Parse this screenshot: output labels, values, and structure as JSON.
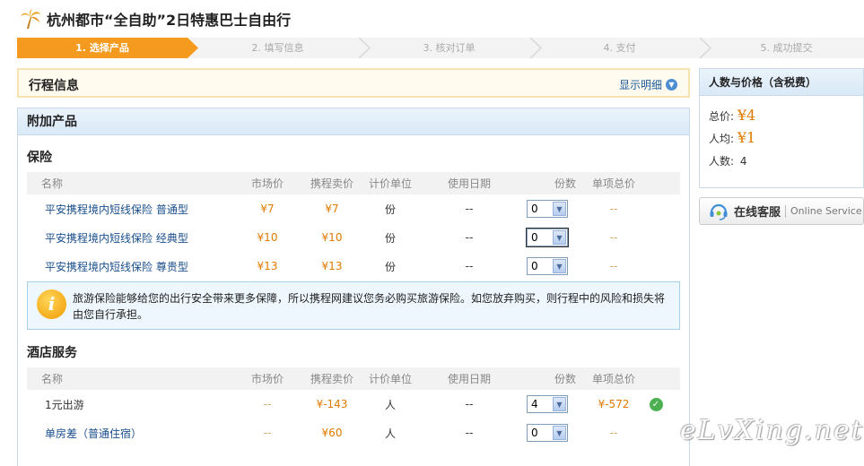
{
  "page": {
    "title": "杭州都市“全自助”2日特惠巴士自由行"
  },
  "steps": [
    {
      "label": "1. 选择产品",
      "active": true
    },
    {
      "label": "2. 填写信息",
      "active": false
    },
    {
      "label": "3. 核对订单",
      "active": false
    },
    {
      "label": "4. 支付",
      "active": false
    },
    {
      "label": "5. 成功提交",
      "active": false
    }
  ],
  "trip": {
    "label": "行程信息",
    "toggle": "显示明细"
  },
  "addons": {
    "title": "附加产品",
    "columns": [
      "名称",
      "市场价",
      "携程卖价",
      "计价单位",
      "使用日期",
      "份数",
      "单项总价"
    ],
    "insurance": {
      "title": "保险",
      "rows": [
        {
          "name": "平安携程境内短线保险 普通型",
          "market": "¥7",
          "price": "¥7",
          "unit": "份",
          "date": "--",
          "qty": "0",
          "total": "--"
        },
        {
          "name": "平安携程境内短线保险 经典型",
          "market": "¥10",
          "price": "¥10",
          "unit": "份",
          "date": "--",
          "qty": "0",
          "total": "--"
        },
        {
          "name": "平安携程境内短线保险 尊贵型",
          "market": "¥13",
          "price": "¥13",
          "unit": "份",
          "date": "--",
          "qty": "0",
          "total": "--"
        }
      ],
      "notice": "旅游保险能够给您的出行安全带来更多保障，所以携程网建议您务必购买旅游保险。如您放弃购买，则行程中的风险和损失将由您自行承担。"
    },
    "hotel": {
      "title": "酒店服务",
      "rows": [
        {
          "name": "1元出游",
          "market": "--",
          "price": "¥-143",
          "unit": "人",
          "date": "--",
          "qty": "4",
          "total": "¥-572"
        },
        {
          "name": "单房差（普通住宿）",
          "market": "--",
          "price": "¥60",
          "unit": "人",
          "date": "--",
          "qty": "0",
          "total": "--"
        }
      ]
    }
  },
  "price": {
    "title": "人数与价格（含税费）",
    "total_label": "总价:",
    "total": "¥4",
    "avg_label": "人均:",
    "avg": "¥1",
    "count_label": "人数:",
    "count": "4"
  },
  "service": {
    "cn": "在线客服",
    "en": "Online Service"
  },
  "watermark": "eLvXing.net",
  "colors": {
    "accent": "#f39a1f",
    "link": "#1a4e8c",
    "price": "#e07a00"
  }
}
